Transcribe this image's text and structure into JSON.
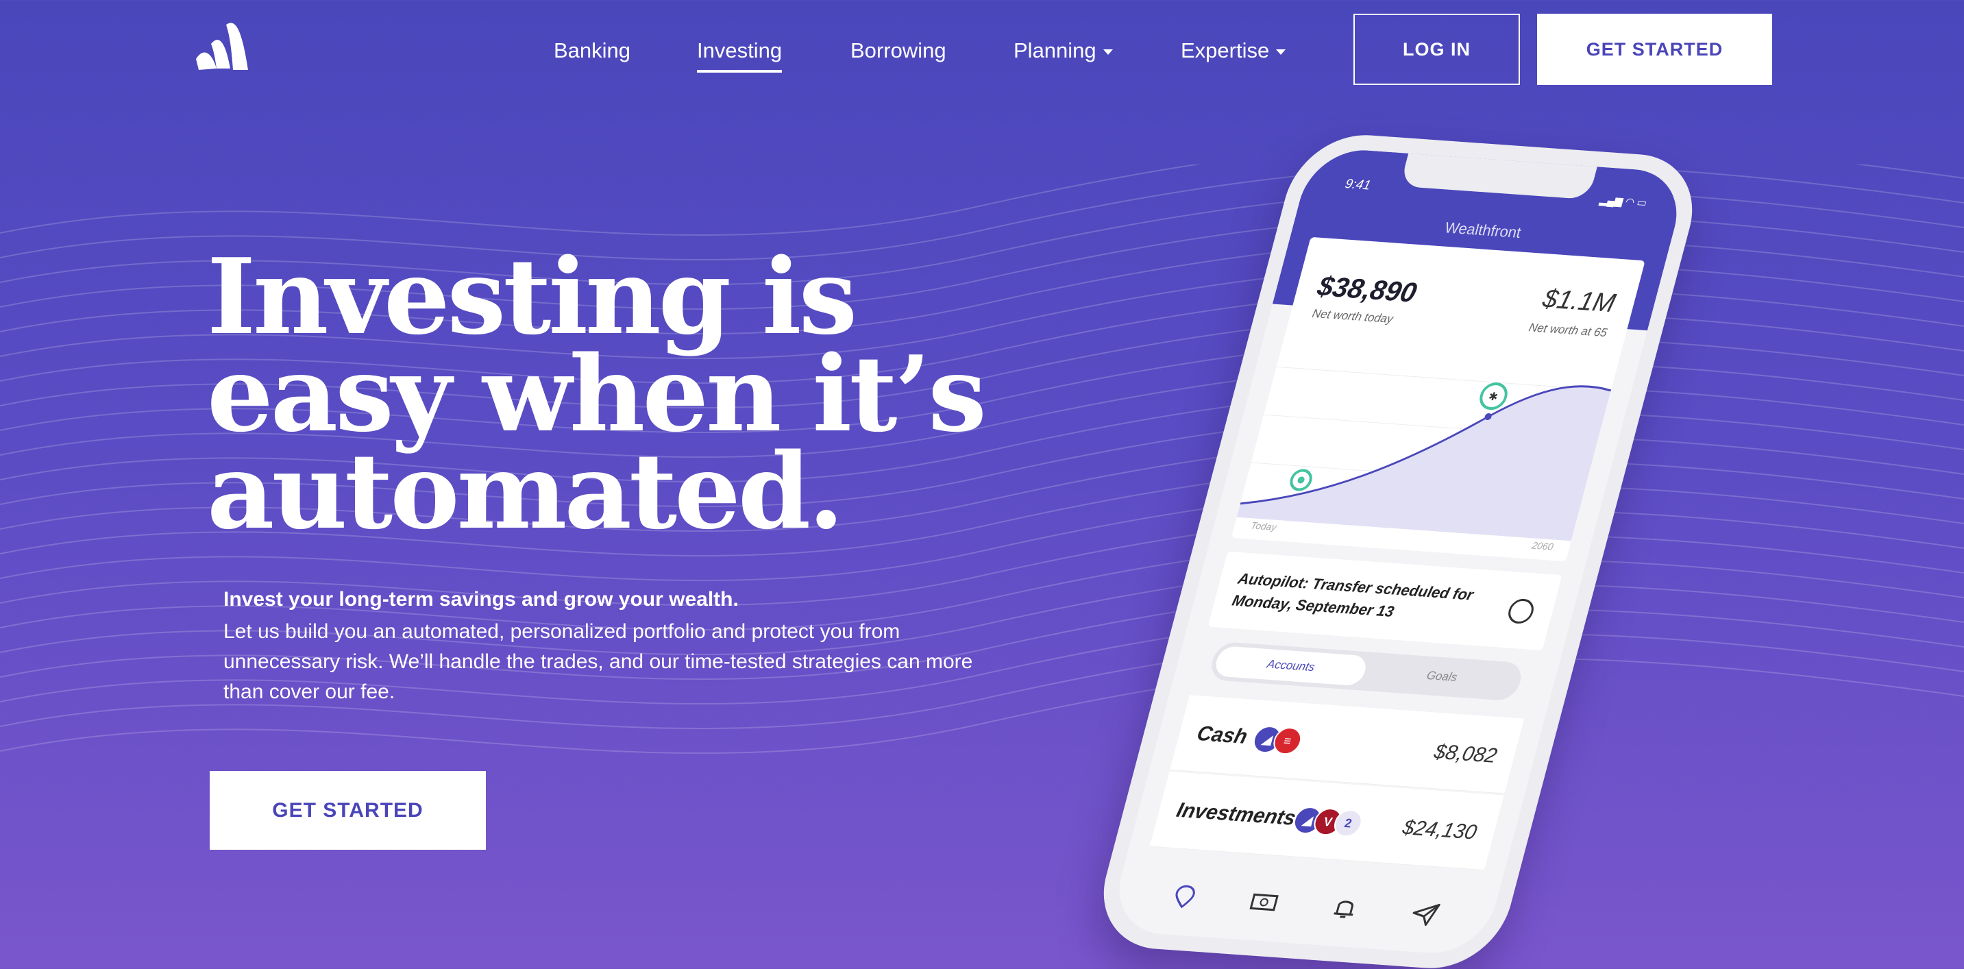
{
  "nav": {
    "items": [
      {
        "label": "Banking"
      },
      {
        "label": "Investing"
      },
      {
        "label": "Borrowing"
      },
      {
        "label": "Planning"
      },
      {
        "label": "Expertise"
      }
    ],
    "active": "Investing",
    "login_label": "LOG IN",
    "get_started_label": "GET STARTED"
  },
  "hero": {
    "headline": [
      "Investing is",
      "easy when it’s",
      "automated."
    ],
    "lead": "Invest your long-term savings and grow your wealth.",
    "body_lines": [
      "Let us build you an automated, personalized portfolio and protect you from",
      "unnecessary risk. We’ll handle the trades, and our time-tested strategies can more",
      "than cover our fee."
    ],
    "cta_label": "GET STARTED"
  },
  "phone": {
    "time": "9:41",
    "app_title": "Wealthfront",
    "net_worth_value": "$38,890",
    "net_worth_label": "Net worth today",
    "projected_value": "$1.1M",
    "projected_label": "Net worth at 65",
    "axis_start": "Today",
    "axis_end": "2060",
    "autopilot_text": "Autopilot: Transfer scheduled for Monday, September 13",
    "tabs": [
      "Accounts",
      "Goals"
    ],
    "accounts": [
      {
        "name": "Cash",
        "amount": "$8,082"
      },
      {
        "name": "Investments",
        "amount": "$24,130",
        "extra_count": "2"
      }
    ]
  },
  "colors": {
    "brand": "#4a47bb",
    "bg_top": "#4a47bb",
    "bg_bottom": "#7a56cc",
    "milestone": "#45c3a0"
  }
}
